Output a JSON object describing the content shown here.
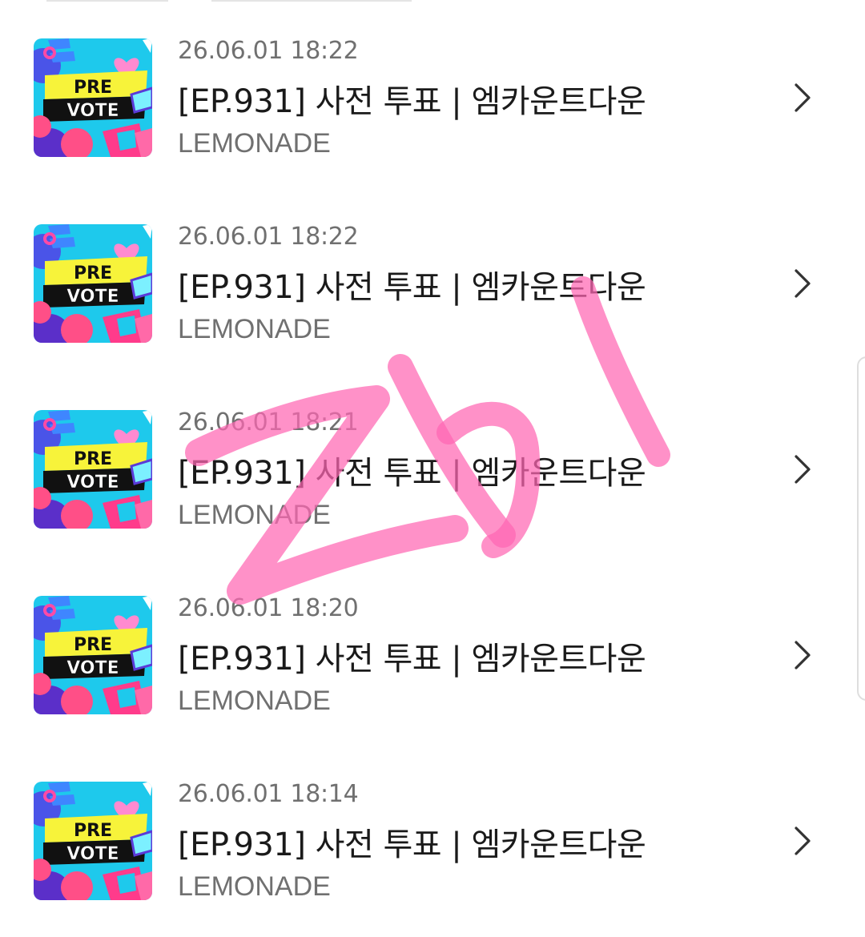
{
  "colors": {
    "date_text": "#707070",
    "title_text": "#1a1a1a",
    "channel_text": "#707070",
    "watermark": "#ff66b3"
  },
  "thumbnail": {
    "line1": "PRE",
    "line2": "VOTE"
  },
  "items": [
    {
      "date": "26.06.01 18:22",
      "title": "[EP.931] 사전 투표 | 엠카운트다운",
      "channel": "LEMONADE"
    },
    {
      "date": "26.06.01 18:22",
      "title": "[EP.931] 사전 투표 | 엠카운트다운",
      "channel": "LEMONADE"
    },
    {
      "date": "26.06.01 18:21",
      "title": "[EP.931] 사전 투표 | 엠카운트다운",
      "channel": "LEMONADE"
    },
    {
      "date": "26.06.01 18:20",
      "title": "[EP.931] 사전 투표 | 엠카운트다운",
      "channel": "LEMONADE"
    },
    {
      "date": "26.06.01 18:14",
      "title": "[EP.931] 사전 투표 | 엠카운트다운",
      "channel": "LEMONADE"
    }
  ],
  "icons": {
    "row_arrow": "chevron-right-icon",
    "watermark": "handwritten-mark"
  }
}
